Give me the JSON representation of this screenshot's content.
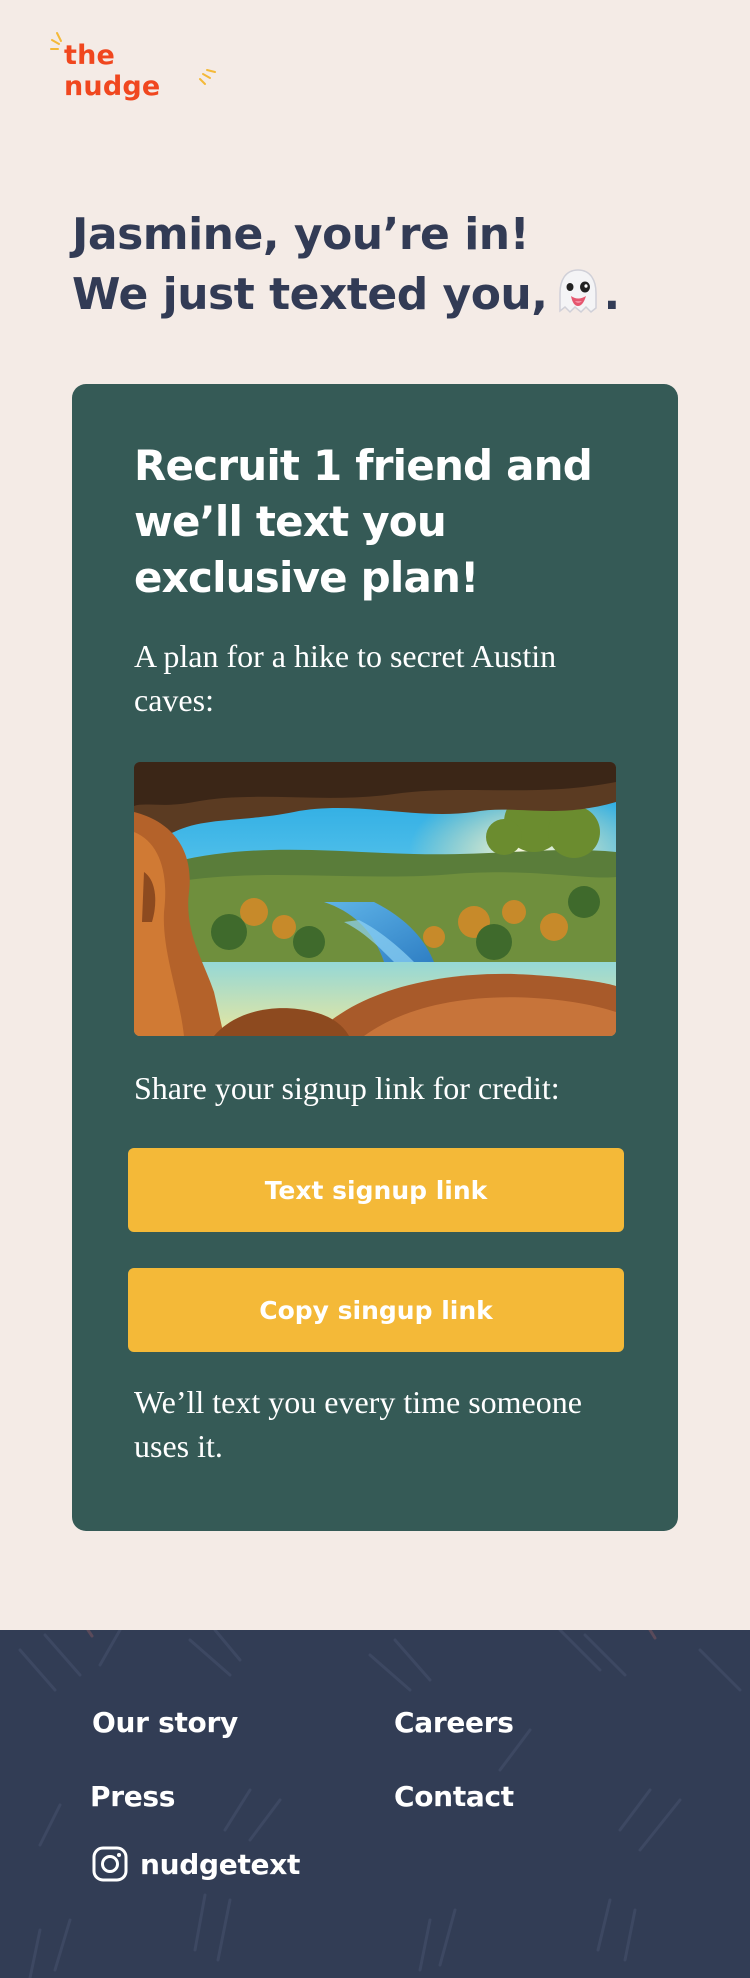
{
  "brand": {
    "logo_text": "the nudge",
    "logo_color": "#f0471f"
  },
  "hero": {
    "line1": "Jasmine, you’re in!",
    "line2": "We just texted you,",
    "line2_end": ".",
    "emoji_icon": "ghost-icon"
  },
  "card": {
    "background": "#355a56",
    "title": "Recruit 1 friend and we’ll text you exclusive plan!",
    "description": "A plan for a hike to secret Austin caves:",
    "image_icon": "cave-landscape-photo",
    "share_label": "Share your signup link for credit:",
    "text_button": "Text signup link",
    "copy_button": "Copy singup link",
    "button_color": "#f4b938",
    "footnote": "We’ll text you every time someone uses it."
  },
  "footer": {
    "background": "#323d55",
    "links": {
      "our_story": "Our story",
      "careers": "Careers",
      "press": "Press",
      "contact": "Contact"
    },
    "instagram": {
      "icon": "instagram-icon",
      "handle": "nudgetext"
    }
  }
}
